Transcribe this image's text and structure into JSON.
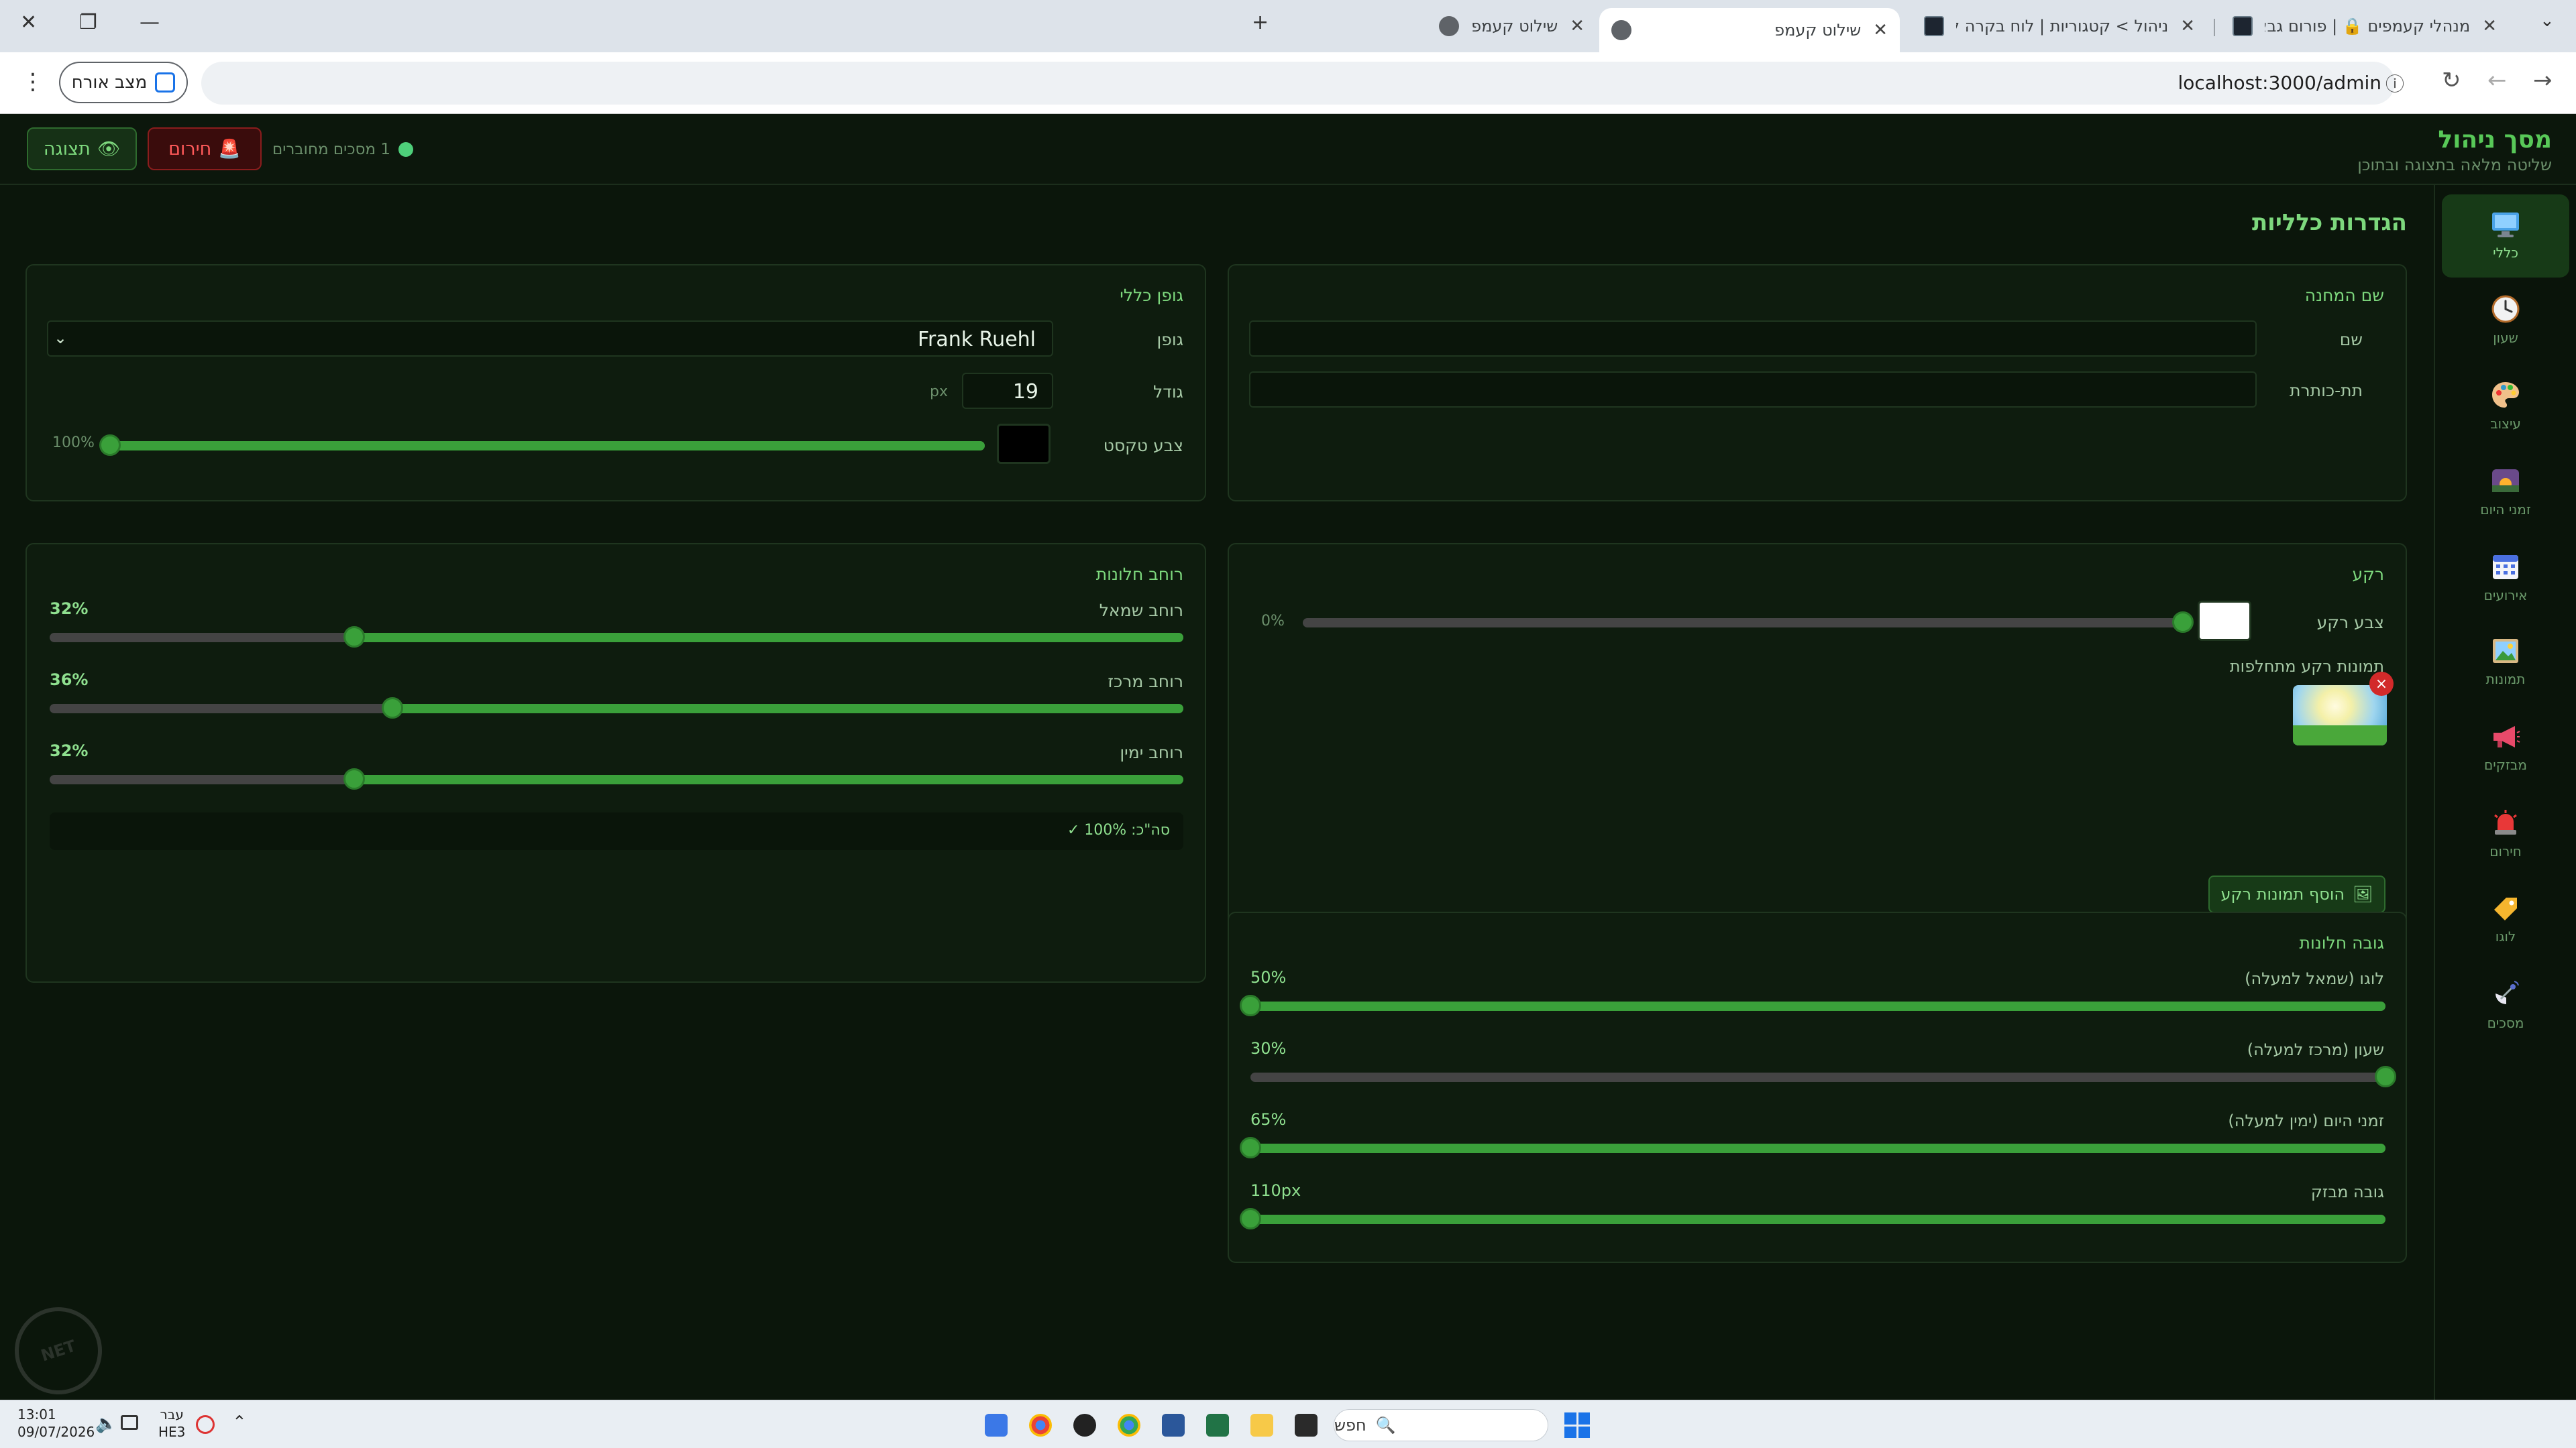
{
  "browser": {
    "tabs": [
      {
        "title": "מנהלי קעמפים 🔒 | פורום גבאים",
        "active": false
      },
      {
        "title": "ניהול > קטגוריות | לוח בקרה למנה",
        "active": false
      },
      {
        "title": "שילוט קעמפ",
        "active": true
      },
      {
        "title": "שילוט קעמפ",
        "active": false
      }
    ],
    "url": "localhost:3000/admin",
    "guest_label": "מצב אורח"
  },
  "app": {
    "title": "מסך ניהול",
    "subtitle": "שליטה מלאה בתצוגה ובתוכן",
    "preview_button": "תצוגה",
    "alarm_button": "חירום",
    "connected": "1 מסכים מחוברים"
  },
  "sidebar": {
    "items": [
      {
        "label": "כללי",
        "icon": "monitor-icon",
        "active": true
      },
      {
        "label": "שעון",
        "icon": "clock-icon",
        "active": false
      },
      {
        "label": "עיצוב",
        "icon": "palette-icon",
        "active": false
      },
      {
        "label": "זמני היום",
        "icon": "sunrise-icon",
        "active": false
      },
      {
        "label": "אירועים",
        "icon": "calendar-icon",
        "active": false
      },
      {
        "label": "תמונות",
        "icon": "image-icon",
        "active": false
      },
      {
        "label": "מבזקים",
        "icon": "megaphone-icon",
        "active": false
      },
      {
        "label": "חירום",
        "icon": "siren-icon",
        "active": false
      },
      {
        "label": "לוגו",
        "icon": "tag-icon",
        "active": false
      },
      {
        "label": "מסכים",
        "icon": "satellite-icon",
        "active": false
      }
    ]
  },
  "page": {
    "title": "הגדרות כלליות"
  },
  "camp_name": {
    "title": "שם המחנה",
    "name_label": "שם",
    "name_value": "",
    "subtitle_label": "תת-כותרת",
    "subtitle_value": ""
  },
  "general_font": {
    "title": "גופן כללי",
    "font_label": "גופן",
    "font_value": "Frank Ruehl",
    "size_label": "גודל",
    "size_value": "19",
    "size_unit": "px",
    "color_label": "צבע טקסט",
    "color_value": "#000000",
    "opacity_label": "100%",
    "opacity": 1.0
  },
  "background": {
    "title": "רקע",
    "color_label": "צבע רקע",
    "color_value": "#ffffff",
    "opacity_label": "0%",
    "opacity": 0.0,
    "images_label": "תמונות רקע מתחלפות",
    "add_button": "הוסף תמונות רקע",
    "remove_symbol": "×"
  },
  "window_widths": {
    "title": "רוחב חלונות",
    "rows": [
      {
        "label": "רוחב שמאל",
        "value_label": "32%",
        "value": 0.32
      },
      {
        "label": "רוחב מרכז",
        "value_label": "36%",
        "value": 0.36
      },
      {
        "label": "רוחב ימין",
        "value_label": "32%",
        "value": 0.32
      }
    ],
    "total": "סה\"כ: 100% ✓"
  },
  "window_heights": {
    "title": "גובה חלונות",
    "rows": [
      {
        "label": "לוגו (שמאל למעלה)",
        "value_label": "50%",
        "value": 0.5
      },
      {
        "label": "שעון (מרכז למעלה)",
        "value_label": "30%",
        "value": 0.3
      },
      {
        "label": "זמני היום (ימין למעלה)",
        "value_label": "65%",
        "value": 0.65
      },
      {
        "label": "גובה מבזק",
        "value_label": "110px",
        "value": 110
      }
    ]
  },
  "taskbar": {
    "time": "13:01",
    "date": "09/07/2026",
    "lang_top": "עבר",
    "lang_bottom": "HE3",
    "search_placeholder": "חפש"
  },
  "colors": {
    "accent": "#3aa03a",
    "accent_text": "#7dd87d",
    "danger": "#ff5a5a",
    "background": "#0b160b",
    "card": "#0e1c0e"
  }
}
